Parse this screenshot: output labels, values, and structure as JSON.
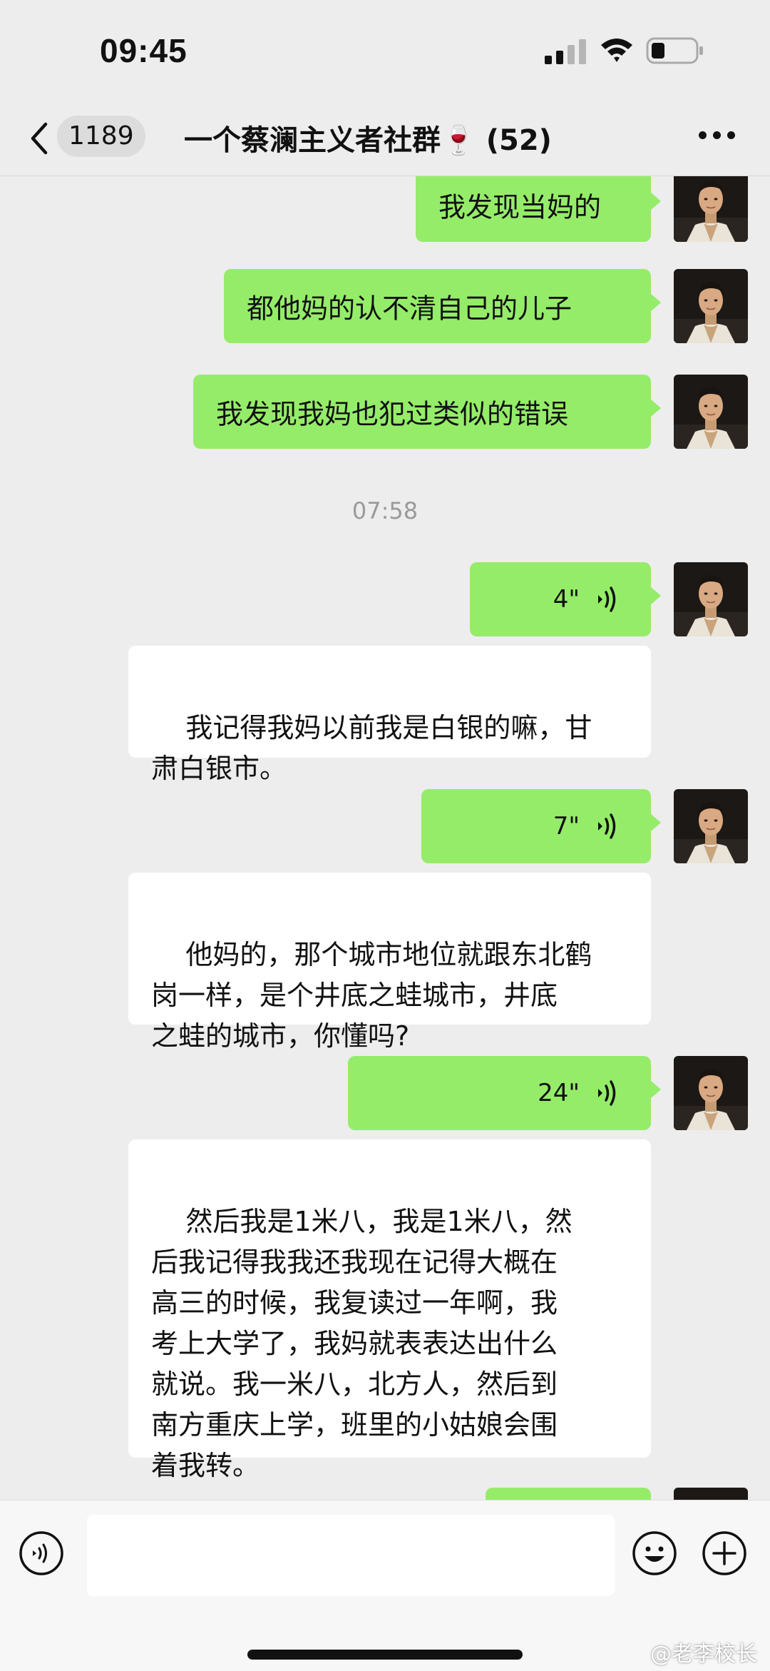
{
  "status_bar": {
    "time": "09:45"
  },
  "header": {
    "back_icon": "chevron-left-icon",
    "unread_count": "1189",
    "title": "一个蔡澜主义者社群🍷 (52)",
    "more_icon": "ellipsis-icon"
  },
  "messages": [
    {
      "type": "text",
      "dir": "out",
      "text": "我发现当妈的"
    },
    {
      "type": "text",
      "dir": "out",
      "text": "都他妈的认不清自己的儿子"
    },
    {
      "type": "text",
      "dir": "out",
      "text": "我发现我妈也犯过类似的错误"
    },
    {
      "type": "time",
      "text": "07:58"
    },
    {
      "type": "voice",
      "dir": "out",
      "duration": "4\""
    },
    {
      "type": "transcript",
      "text": "我记得我妈以前我是白银的嘛，甘\n肃白银市。"
    },
    {
      "type": "voice",
      "dir": "out",
      "duration": "7\""
    },
    {
      "type": "transcript",
      "text": "他妈的，那个城市地位就跟东北鹤\n岗一样，是个井底之蛙城市，井底\n之蛙的城市，你懂吗?"
    },
    {
      "type": "voice",
      "dir": "out",
      "duration": "24\""
    },
    {
      "type": "transcript",
      "text": "然后我是1米八，我是1米八，然\n后我记得我我还我现在记得大概在\n高三的时候，我复读过一年啊，我\n考上大学了，我妈就表表达出什么\n就说。我一米八，北方人，然后到\n南方重庆上学，班里的小姑娘会围\n着我转。"
    }
  ],
  "input_bar": {
    "voice_icon": "voice-mode-icon",
    "emoji_icon": "emoji-icon",
    "plus_icon": "plus-icon",
    "text_value": ""
  },
  "watermark": "@老李校长",
  "colors": {
    "background": "#ededed",
    "outgoing_bubble": "#95ec69",
    "incoming_bubble": "#ffffff",
    "timestamp": "#9a9a9a"
  }
}
